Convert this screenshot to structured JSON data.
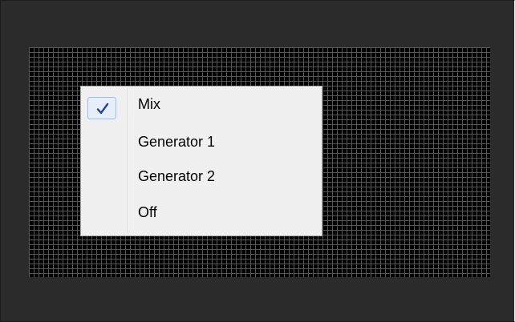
{
  "context_menu": {
    "items": [
      {
        "label": "Mix",
        "checked": true
      },
      {
        "label": "Generator 1",
        "checked": false
      },
      {
        "label": "Generator 2",
        "checked": false
      },
      {
        "label": "Off",
        "checked": false
      }
    ]
  },
  "icons": {
    "check": "checkmark-icon"
  },
  "colors": {
    "window_background": "#2b2b2b",
    "grid_background": "#000000",
    "grid_lines": "#575757",
    "menu_background": "#f0f0f0",
    "check_highlight": "#e6eefb",
    "check_color": "#1f3fa8"
  }
}
